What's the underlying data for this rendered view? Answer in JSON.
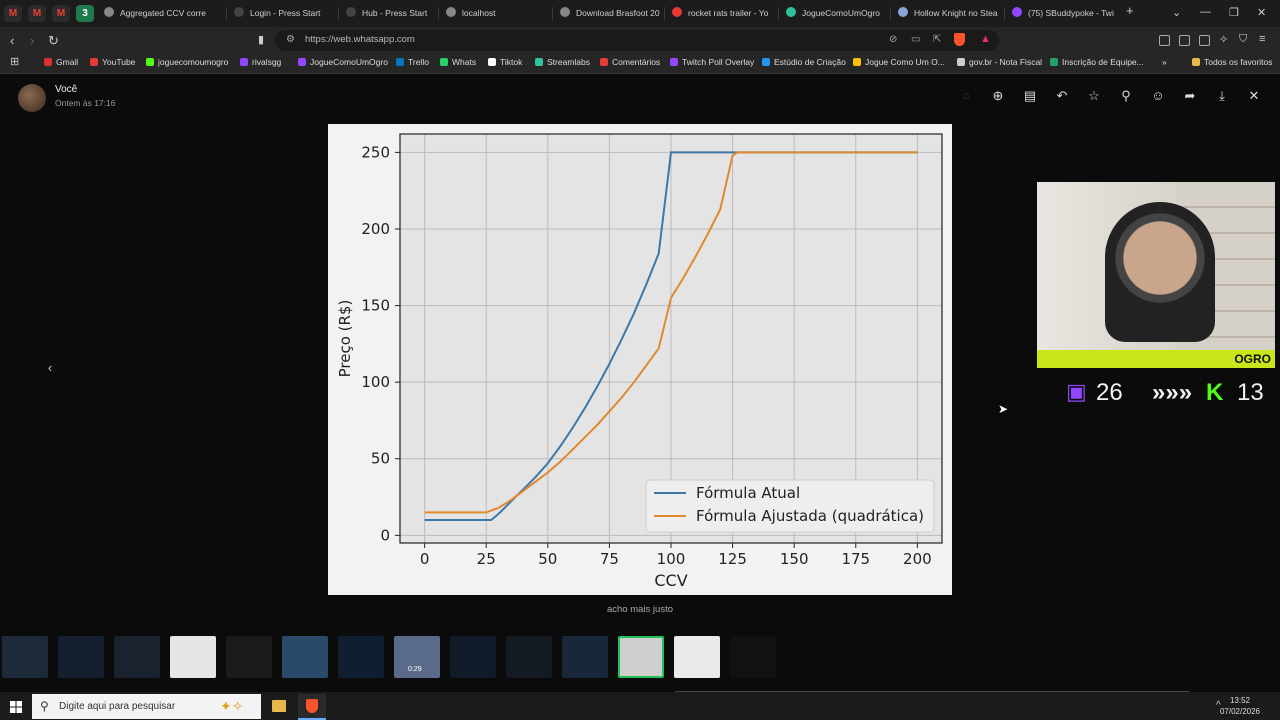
{
  "browser": {
    "pinned_tabs": [
      "M",
      "M",
      "M",
      "3"
    ],
    "tabs": [
      {
        "title": "Aggregated CCV corre",
        "color": "#888"
      },
      {
        "title": "Login - Press Start",
        "color": "#444"
      },
      {
        "title": "Hub - Press Start",
        "color": "#444"
      },
      {
        "title": "localhost",
        "color": "#888"
      },
      {
        "title": "Download Brasfoot 20",
        "color": "#888"
      },
      {
        "title": "rocket rats trailer - Yo",
        "color": "#e53935"
      },
      {
        "title": "JogueComoUmOgro",
        "color": "#2fbf9b"
      },
      {
        "title": "Hollow Knight no Stea",
        "color": "#89a7d6"
      },
      {
        "title": "(75) SBuddypoke - Twi",
        "color": "#9146ff"
      }
    ],
    "new_tab": "+",
    "url": "https://web.whatsapp.com",
    "bookmarks": [
      {
        "label": "Gmail",
        "color": "#d33"
      },
      {
        "label": "YouTube",
        "color": "#e53935"
      },
      {
        "label": "joguecomoumogro",
        "color": "#53fc18"
      },
      {
        "label": "rivalsgg",
        "color": "#9146ff"
      },
      {
        "label": "JogueComoUmOgro",
        "color": "#9146ff"
      },
      {
        "label": "Trello",
        "color": "#0079bf"
      },
      {
        "label": "Whats",
        "color": "#25d366"
      },
      {
        "label": "Tiktok",
        "color": "#ffffff"
      },
      {
        "label": "Streamlabs",
        "color": "#31c3a2"
      },
      {
        "label": "Comentários",
        "color": "#e53935"
      },
      {
        "label": "Twitch Poll Overlay",
        "color": "#9146ff"
      },
      {
        "label": "Estúdio de Criação",
        "color": "#2196f3"
      },
      {
        "label": "Jogue Como Um O...",
        "color": "#ffc107"
      },
      {
        "label": "gov.br - Nota Fiscal",
        "color": "#cccccc"
      },
      {
        "label": "Inscrição de Equipe...",
        "color": "#21a366"
      }
    ],
    "more": "»",
    "all_favorites": "Todos os favoritos"
  },
  "viewer": {
    "sender": "Você",
    "time": "Ontem às 17:16",
    "caption": "acho mais justo",
    "prev": "‹"
  },
  "chart_data": {
    "type": "line",
    "xlabel": "CCV",
    "ylabel": "Preço (R$)",
    "xlim": [
      -10,
      210
    ],
    "ylim": [
      -5,
      262
    ],
    "xticks": [
      0,
      25,
      50,
      75,
      100,
      125,
      150,
      175,
      200
    ],
    "yticks": [
      0,
      50,
      100,
      150,
      200,
      250
    ],
    "grid": true,
    "legend": "bottom-right",
    "series": [
      {
        "name": "Fórmula Atual",
        "color": "#3b78a8",
        "x": [
          0,
          5,
          10,
          15,
          20,
          25,
          27,
          30,
          35,
          40,
          45,
          50,
          55,
          60,
          65,
          70,
          75,
          80,
          85,
          90,
          95,
          100,
          105,
          110,
          115,
          120,
          125,
          130,
          135,
          140,
          145,
          150,
          155,
          160,
          165,
          170,
          175,
          180,
          185,
          190,
          195,
          200
        ],
        "y": [
          10,
          10,
          10,
          10,
          10,
          10,
          10,
          14,
          22,
          30,
          38,
          47,
          58,
          70,
          83,
          97,
          112,
          128,
          145,
          164,
          184,
          250,
          250,
          250,
          250,
          250,
          250,
          250,
          250,
          250,
          250,
          250,
          250,
          250,
          250,
          250,
          250,
          250,
          250,
          250,
          250,
          250
        ]
      },
      {
        "name": "Fórmula Ajustada (quadrática)",
        "color": "#e08a2e",
        "x": [
          0,
          5,
          10,
          15,
          20,
          25,
          30,
          35,
          40,
          45,
          50,
          55,
          60,
          65,
          70,
          75,
          80,
          85,
          90,
          95,
          100,
          105,
          110,
          115,
          120,
          125,
          127,
          130,
          135,
          140,
          145,
          150,
          155,
          160,
          165,
          170,
          175,
          180,
          185,
          190,
          195,
          200
        ],
        "y": [
          15,
          15,
          15,
          15,
          15,
          15,
          18,
          23,
          29,
          35,
          41,
          48,
          56,
          64,
          72,
          81,
          90,
          100,
          111,
          122,
          155,
          168,
          182,
          197,
          213,
          248,
          250,
          250,
          250,
          250,
          250,
          250,
          250,
          250,
          250,
          250,
          250,
          250,
          250,
          250,
          250,
          250
        ]
      }
    ]
  },
  "overlay": {
    "name": "OGRO",
    "twitch_count": "26",
    "arrows": "»»»",
    "kick_count": "13",
    "twitch_color": "#9146ff",
    "kick_color": "#53fc18"
  },
  "taskbar": {
    "search_placeholder": "Digite aqui para pesquisar",
    "time": "13:52",
    "date": "07/02/2026",
    "video_duration": "0:29"
  }
}
